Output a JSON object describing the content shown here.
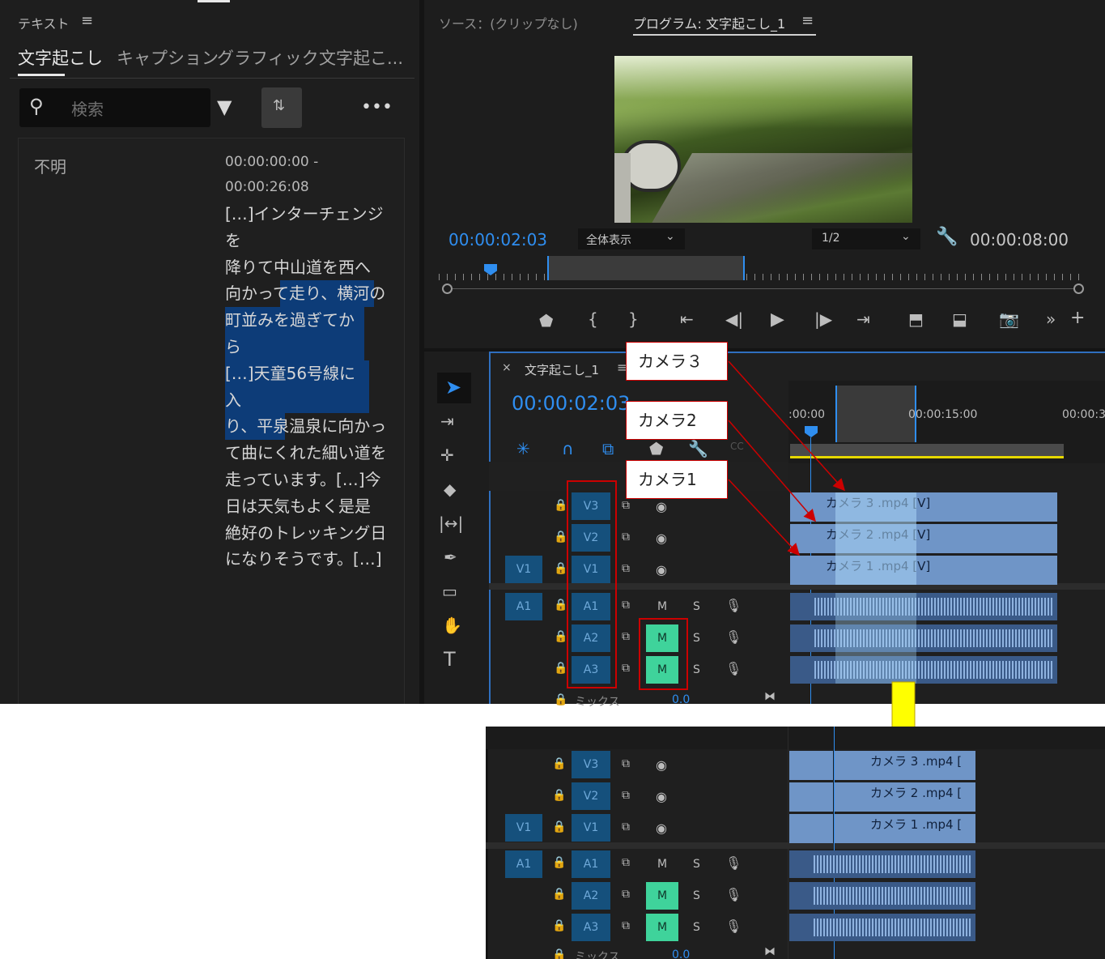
{
  "text_panel": {
    "title": "テキスト",
    "tabs": [
      "文字起こし",
      "キャプション",
      "グラフィック",
      "文字起こ..."
    ],
    "search_placeholder": "検索",
    "speaker": "不明",
    "time_start": "00:00:00:00 -",
    "time_end": "00:00:26:08",
    "lines": [
      "[…]インターチェンジを",
      "降りて中山道を西へ",
      "向かって走り、横河の",
      "町並みを過ぎてから",
      "[…]天童56号線に入",
      "り、平泉温泉に向かっ",
      "て曲にくれた細い道を",
      "走っています。[…]今",
      "日は天気もよく是是",
      "絶好のトレッキング日",
      "になりそうです。[…]"
    ]
  },
  "monitor": {
    "source_tab": "ソース：(クリップなし)",
    "program_tab": "プログラム: 文字起こし_1",
    "current_time": "00:00:02:03",
    "fit_label": "全体表示",
    "resolution": "1/2",
    "duration": "00:00:08:00"
  },
  "timeline": {
    "sequence_name": "文字起こし_1",
    "current_time": "00:00:02:03",
    "ruler": [
      ":00:00",
      "00:00:15:00",
      "00:00:3"
    ],
    "tracks": {
      "v3": "V3",
      "v2": "V2",
      "v1": "V1",
      "src_v1": "V1",
      "a1": "A1",
      "a2": "A2",
      "a3": "A3",
      "src_a1": "A1",
      "mute": "M",
      "solo": "S",
      "mix": "ミックス",
      "mix_val": "0.0"
    },
    "clips": {
      "v3": "カメラ 3 .mp4 [V]",
      "v2": "カメラ 2 .mp4 [V]",
      "v1": "カメラ 1 .mp4 [V]",
      "v3_short": "カメラ 3 .mp4 [",
      "v2_short": "カメラ 2 .mp4 [",
      "v1_short": "カメラ 1 .mp4 ["
    }
  },
  "callouts": [
    "カメラ３",
    "カメラ2",
    "カメラ1"
  ],
  "colors": {
    "accent": "#2f8ef0",
    "mute_on": "#3fd39b",
    "track_on": "#15507c",
    "annotation": "#cc0000",
    "arrow": "#ffff00"
  }
}
